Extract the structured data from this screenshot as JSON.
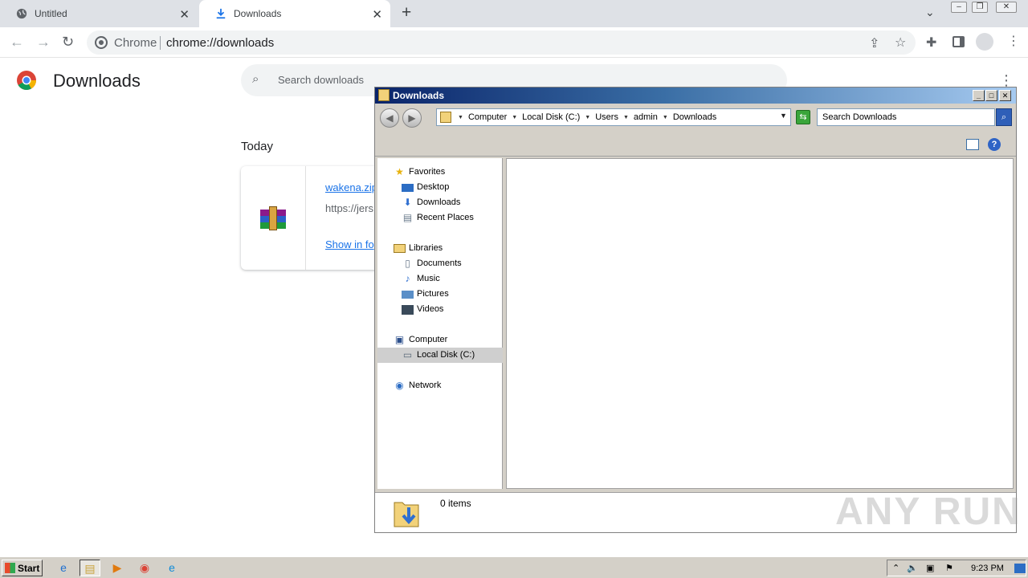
{
  "browser": {
    "tabs": [
      {
        "label": "Untitled",
        "icon": "globe-icon"
      },
      {
        "label": "Downloads",
        "icon": "download-icon"
      }
    ],
    "omnibox": {
      "site": "Chrome",
      "url": "chrome://downloads"
    }
  },
  "downloads_page": {
    "title": "Downloads",
    "search_placeholder": "Search downloads",
    "section": "Today",
    "item": {
      "filename": "wakena.zip",
      "url": "https://jers",
      "action": "Show in fo"
    }
  },
  "explorer": {
    "title": "Downloads",
    "breadcrumb": [
      "Computer",
      "Local Disk (C:)",
      "Users",
      "admin",
      "Downloads"
    ],
    "search_placeholder": "Search Downloads",
    "nav": {
      "favorites": {
        "label": "Favorites",
        "items": [
          "Desktop",
          "Downloads",
          "Recent Places"
        ]
      },
      "libraries": {
        "label": "Libraries",
        "items": [
          "Documents",
          "Music",
          "Pictures",
          "Videos"
        ]
      },
      "computer": {
        "label": "Computer",
        "items": [
          "Local Disk (C:)"
        ]
      },
      "network": {
        "label": "Network"
      }
    },
    "selected_nav": "Local Disk (C:)",
    "status": "0 items"
  },
  "watermark": "ANY RUN",
  "taskbar": {
    "start_label": "Start",
    "clock": "9:23 PM"
  },
  "colors": {
    "chrome_tabstrip": "#dee1e6",
    "link_blue": "#1a73e8",
    "explorer_title_dark": "#0a246a",
    "explorer_title_light": "#a6caf0",
    "classic_face": "#d4d0c8"
  }
}
